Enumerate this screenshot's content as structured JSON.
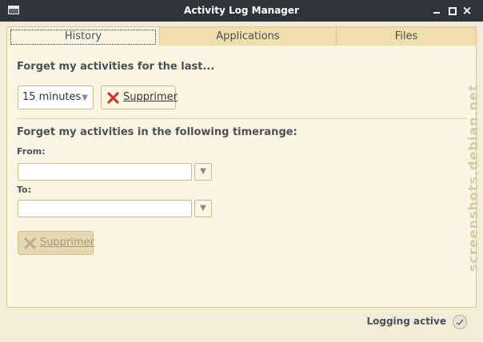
{
  "window": {
    "title": "Activity Log Manager"
  },
  "tabs": [
    {
      "label": "History"
    },
    {
      "label": "Applications"
    },
    {
      "label": "Files"
    }
  ],
  "history": {
    "forget_last_heading": "Forget my activities for the last...",
    "duration_select": {
      "value": "15 minutes"
    },
    "delete_button": {
      "label": "Supprimer"
    },
    "timerange_heading": "Forget my activities in the following timerange:",
    "from_label": "From:",
    "from_value": "",
    "to_label": "To:",
    "to_value": "",
    "timerange_delete_button": {
      "label": "Supprimer",
      "enabled": false
    }
  },
  "status": {
    "text": "Logging active"
  },
  "watermark": "screenshots.debian.net",
  "colors": {
    "titlebar": "#2f333a",
    "background": "#f3ecd7",
    "tab_bar": "#f0dfad",
    "delete_icon": "#d9342b"
  }
}
